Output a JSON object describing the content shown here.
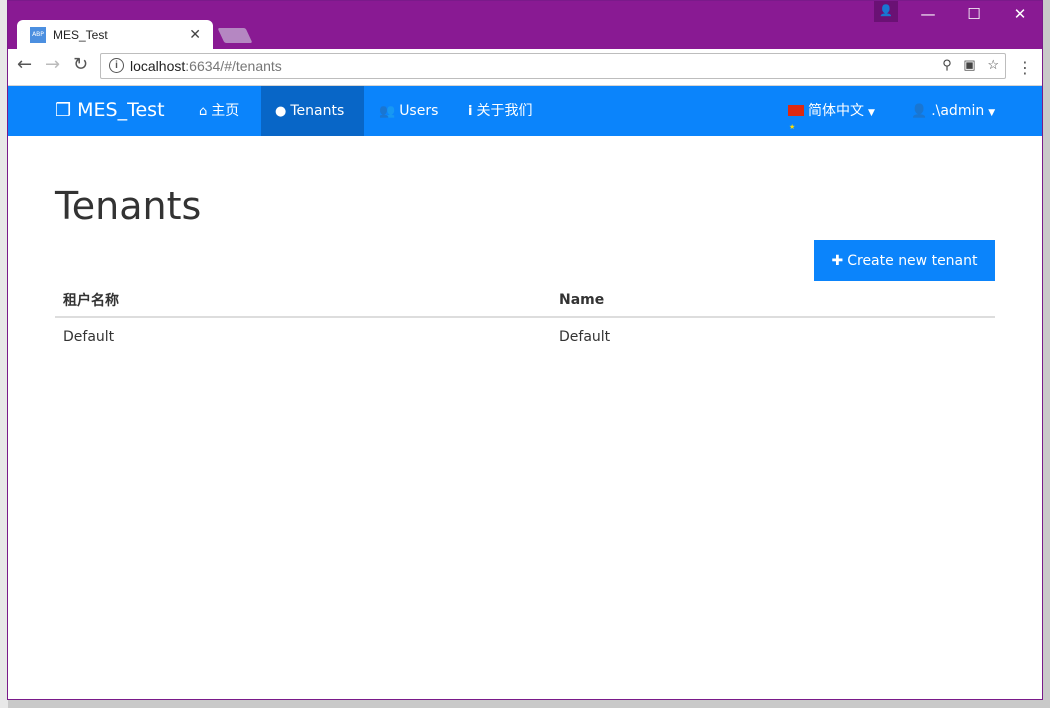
{
  "browser": {
    "tab_title": "MES_Test",
    "favicon_text": "ABP",
    "tab_close": "✕",
    "url_host": "localhost",
    "url_rest": ":6634/#/tenants",
    "window_controls": [
      "—",
      "☐",
      "✕"
    ]
  },
  "navbar": {
    "brand": "MES_Test",
    "brand_icon": "cubes-icon",
    "items": [
      {
        "label": "主页",
        "icon": "home-icon",
        "active": false
      },
      {
        "label": "Tenants",
        "icon": "globe-icon",
        "active": true
      },
      {
        "label": "Users",
        "icon": "users-icon",
        "active": false
      },
      {
        "label": "关于我们",
        "icon": "info-icon",
        "active": false
      }
    ],
    "language": "简体中文",
    "user": ".\\admin"
  },
  "page": {
    "title": "Tenants",
    "create_button": "Create new tenant",
    "table": {
      "headers": [
        "租户名称",
        "Name"
      ],
      "rows": [
        [
          "Default",
          "Default"
        ]
      ]
    }
  },
  "colors": {
    "titlebar": "#891a93",
    "navbar": "#0b84fb",
    "navbar_active": "#0866c7",
    "button": "#0b84fb"
  }
}
